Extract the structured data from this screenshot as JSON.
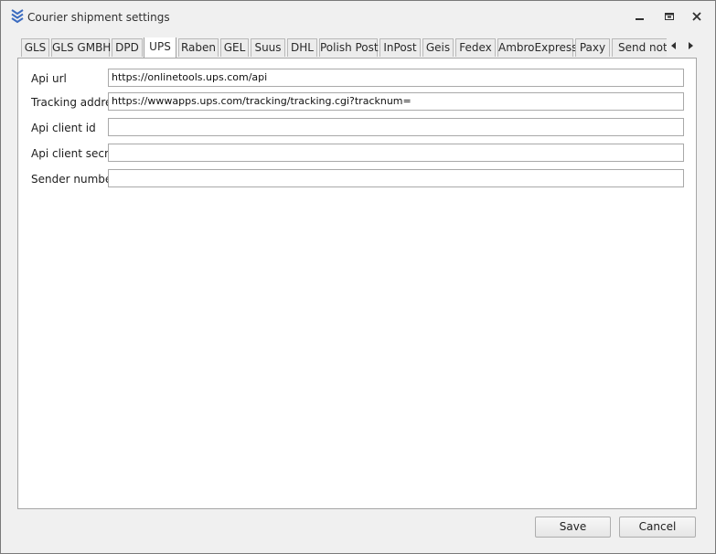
{
  "window": {
    "title": "Courier shipment settings",
    "app_icon": "chevron-layers-icon",
    "controls": [
      "minimize-icon",
      "restore-icon",
      "close-icon"
    ]
  },
  "tabs": [
    {
      "label": "GLS"
    },
    {
      "label": "GLS GMBH"
    },
    {
      "label": "DPD"
    },
    {
      "label": "UPS",
      "active": true
    },
    {
      "label": "Raben"
    },
    {
      "label": "GEL"
    },
    {
      "label": "Suus"
    },
    {
      "label": "DHL"
    },
    {
      "label": "Polish Post"
    },
    {
      "label": "InPost"
    },
    {
      "label": "Geis"
    },
    {
      "label": "Fedex"
    },
    {
      "label": "AmbroExpress"
    },
    {
      "label": "Paxy"
    },
    {
      "label": "Send notifi"
    }
  ],
  "tab_scroll": [
    "scroll-left-icon",
    "scroll-right-icon"
  ],
  "form": {
    "api_url": {
      "label": "Api url",
      "value": "https://onlinetools.ups.com/api"
    },
    "tracking_address": {
      "label": "Tracking address",
      "value": "https://wwwapps.ups.com/tracking/tracking.cgi?tracknum="
    },
    "api_client_id": {
      "label": "Api client id",
      "value": ""
    },
    "api_client_secret": {
      "label": "Api client secret",
      "value": ""
    },
    "sender_number": {
      "label": "Sender number",
      "value": ""
    }
  },
  "buttons": {
    "save": "Save",
    "cancel": "Cancel"
  },
  "colors": {
    "accent": "#3c6cc0",
    "window_bg": "#f0f0f0",
    "panel_bg": "#ffffff"
  }
}
